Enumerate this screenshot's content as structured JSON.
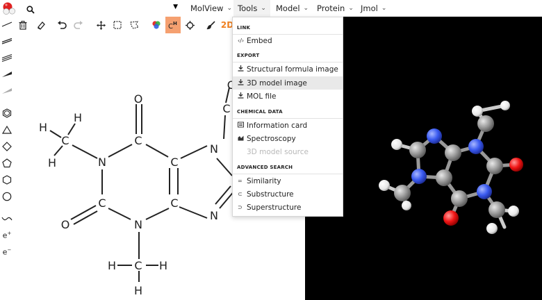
{
  "search": {
    "value": "",
    "placeholder": ""
  },
  "menubar": [
    {
      "id": "molview",
      "label": "MolView"
    },
    {
      "id": "tools",
      "label": "Tools"
    },
    {
      "id": "model",
      "label": "Model"
    },
    {
      "id": "protein",
      "label": "Protein"
    },
    {
      "id": "jmol",
      "label": "Jmol"
    }
  ],
  "toolbar": {
    "mode_2d": "2D"
  },
  "left_tools": {
    "e_plus": "e",
    "e_minus": "e",
    "plus": "+",
    "minus": "−"
  },
  "tools_menu": {
    "sections": [
      {
        "title": "LINK",
        "items": [
          {
            "label": "Embed",
            "icon": "code-icon",
            "enabled": true
          }
        ]
      },
      {
        "title": "EXPORT",
        "items": [
          {
            "label": "Structural formula image",
            "icon": "download-icon",
            "enabled": true
          },
          {
            "label": "3D model image",
            "icon": "download-icon",
            "enabled": true,
            "highlighted": true
          },
          {
            "label": "MOL file",
            "icon": "download-icon",
            "enabled": true
          }
        ]
      },
      {
        "title": "CHEMICAL DATA",
        "items": [
          {
            "label": "Information card",
            "icon": "card-icon",
            "enabled": true
          },
          {
            "label": "Spectroscopy",
            "icon": "chart-icon",
            "enabled": true
          },
          {
            "label": "3D model source",
            "icon": "",
            "enabled": false
          }
        ]
      },
      {
        "title": "ADVANCED SEARCH",
        "items": [
          {
            "label": "Similarity",
            "icon": "equals-icon",
            "enabled": true
          },
          {
            "label": "Substructure",
            "icon": "subset-icon",
            "enabled": true
          },
          {
            "label": "Superstructure",
            "icon": "superset-icon",
            "enabled": true
          }
        ]
      }
    ]
  },
  "molecule_2d": {
    "atoms": [
      "O",
      "C",
      "H",
      "H",
      "C",
      "H",
      "N",
      "C",
      "C",
      "N",
      "C",
      "N",
      "C",
      "C",
      "O",
      "N",
      "H",
      "C",
      "H",
      "H",
      "O",
      "C",
      "N"
    ]
  },
  "colors": {
    "accent_orange": "#f08020",
    "active_tool": "#f5a070",
    "carbon": "#909090",
    "nitrogen": "#3050f8",
    "oxygen": "#ff0d0d",
    "hydrogen": "#ffffff"
  }
}
